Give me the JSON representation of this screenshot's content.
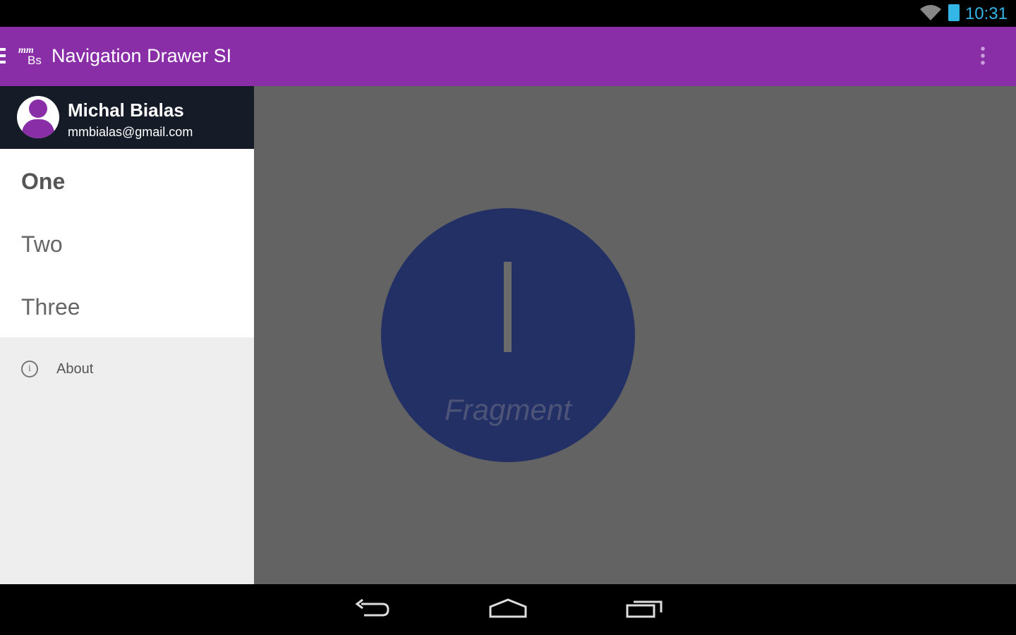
{
  "status_bar": {
    "time": "10:31",
    "icons": [
      "wifi-icon",
      "battery-charging-icon"
    ],
    "clock_color": "#33b5e5"
  },
  "app_bar": {
    "logo_top": "mm",
    "logo_bottom": "Bs",
    "title": "Navigation Drawer SI",
    "color": "#8a2ea8"
  },
  "drawer": {
    "user": {
      "name": "Michal Bialas",
      "email": "mmbialas@gmail.com"
    },
    "items": [
      {
        "label": "One",
        "active": true
      },
      {
        "label": "Two"
      },
      {
        "label": "Three"
      }
    ],
    "footer_item": {
      "label": "About",
      "icon": "info-icon"
    }
  },
  "content": {
    "numeral": "I",
    "label": "Fragment"
  },
  "nav_bar": {
    "buttons": [
      "back",
      "home",
      "recents"
    ]
  }
}
